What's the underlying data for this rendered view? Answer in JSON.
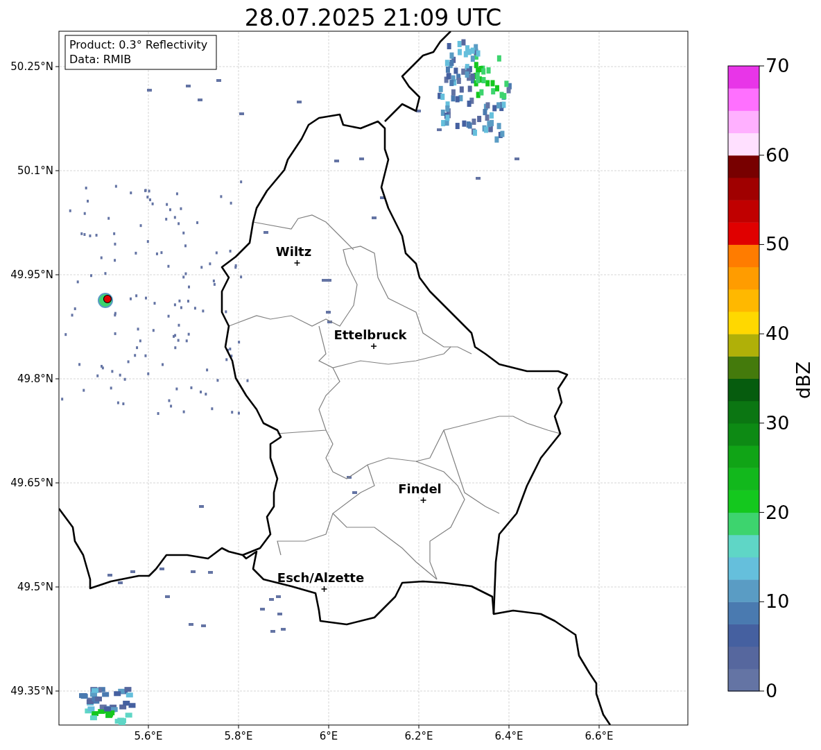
{
  "title": "28.07.2025 21:09 UTC",
  "info_box": [
    "Product: 0.3° Reflectivity",
    "Data: RMIB"
  ],
  "x_ticks": [
    "5.6°E",
    "5.8°E",
    "6°E",
    "6.2°E",
    "6.4°E",
    "6.6°E"
  ],
  "y_ticks": [
    "50.25°N",
    "50.1°N",
    "49.95°N",
    "49.8°N",
    "49.65°N",
    "49.5°N",
    "49.35°N"
  ],
  "cities": [
    {
      "name": "Wiltz"
    },
    {
      "name": "Ettelbruck"
    },
    {
      "name": "Findel"
    },
    {
      "name": "Esch/Alzette"
    }
  ],
  "colorbar": {
    "label": "dBZ",
    "ticks": [
      "70",
      "60",
      "50",
      "40",
      "30",
      "20",
      "10",
      "0"
    ],
    "bins": [
      {
        "color": "#6474a4"
      },
      {
        "color": "#56679e"
      },
      {
        "color": "#4560a0"
      },
      {
        "color": "#4a7ab0"
      },
      {
        "color": "#5a9cc4"
      },
      {
        "color": "#65bfdc"
      },
      {
        "color": "#5fd6c6"
      },
      {
        "color": "#3dd46e"
      },
      {
        "color": "#14c81e"
      },
      {
        "color": "#12b81c"
      },
      {
        "color": "#10a416"
      },
      {
        "color": "#0d8a14"
      },
      {
        "color": "#0b7612"
      },
      {
        "color": "#065c0e"
      },
      {
        "color": "#447a0c"
      },
      {
        "color": "#b0b008"
      },
      {
        "color": "#ffd800"
      },
      {
        "color": "#ffb800"
      },
      {
        "color": "#ff9c00"
      },
      {
        "color": "#ff7c00"
      },
      {
        "color": "#e00000"
      },
      {
        "color": "#c00000"
      },
      {
        "color": "#a00000"
      },
      {
        "color": "#780000"
      },
      {
        "color": "#ffe0ff"
      },
      {
        "color": "#ffb0ff"
      },
      {
        "color": "#ff70ff"
      },
      {
        "color": "#e835e8"
      }
    ]
  }
}
